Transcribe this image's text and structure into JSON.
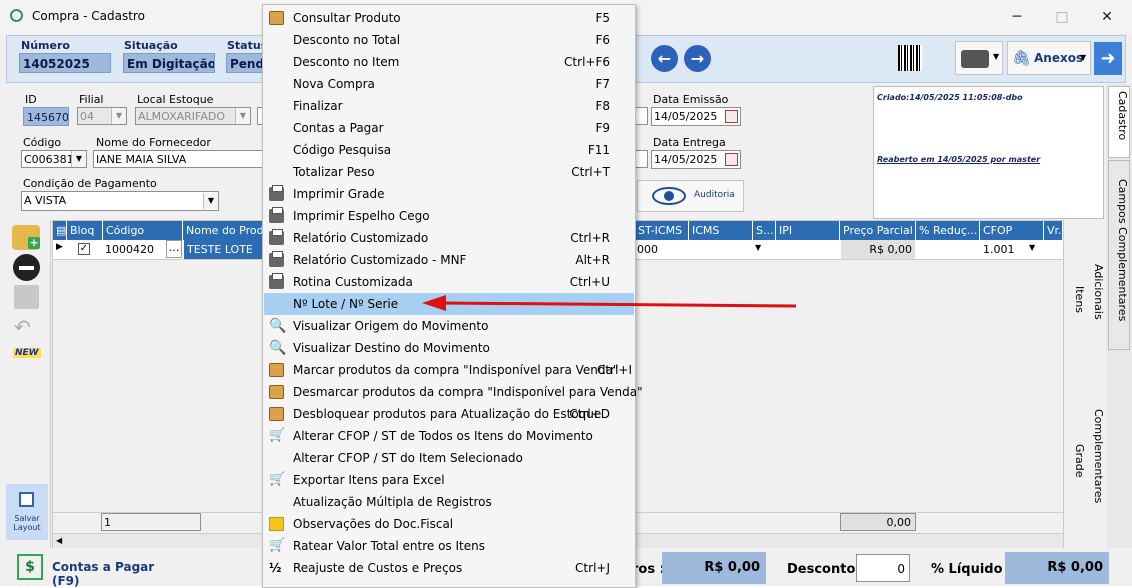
{
  "window": {
    "title": "Compra - Cadastro",
    "minimize": "─",
    "maximize": "□",
    "close": "✕"
  },
  "header": {
    "numero_label": "Número",
    "numero_value": "14052025",
    "situacao_label": "Situação",
    "situacao_value": "Em Digitação",
    "status_label": "Status",
    "status_value": "Pende",
    "anexos_label": "Anexos"
  },
  "form": {
    "id_label": "ID",
    "id_value": "145670",
    "filial_label": "Filial",
    "filial_value": "04",
    "local_estoque_label": "Local Estoque",
    "local_estoque_value": "ALMOXARIFADO",
    "data_emissao_label": "Data Emissão",
    "data_emissao_value": "14/05/2025",
    "codigo_label": "Código",
    "codigo_value": "C006381",
    "fornecedor_label": "Nome do Fornecedor",
    "fornecedor_value": "IANE MAIA SILVA",
    "data_entrega_label": "Data Entrega",
    "data_entrega_value": "14/05/2025",
    "cond_pagamento_label": "Condição de Pagamento",
    "cond_pagamento_value": "A VISTA",
    "auditoria_label": "Auditoria"
  },
  "log": {
    "criado": "Criado:14/05/2025 11:05:08-dbo",
    "reaberto": "Reaberto em 14/05/2025 por master"
  },
  "grid": {
    "headers": [
      "Bloq",
      "Código",
      "Nome do Prod",
      "ST-ICMS",
      "ICMS",
      "S...",
      "IPI",
      "Preço Parcial",
      "% Reduç...",
      "CFOP",
      "Vr.F"
    ],
    "row": {
      "codigo": "1000420",
      "nome": "TESTE LOTE",
      "st_icms": "000",
      "preco_parcial": "R$ 0,00",
      "cfop": "1.001"
    },
    "footer_count": "1",
    "footer_total": "0,00"
  },
  "left_toolbar": {
    "new_label": "NEW",
    "salvar_layout": "Salvar Layout"
  },
  "right_tabs": [
    "Cadastro",
    "Campos Complementares",
    "Adicionais",
    "Itens",
    "Complementares",
    "Grade"
  ],
  "bottom": {
    "contas_pagar": "Contas a Pagar (F9)",
    "tros_label": "ros :",
    "tros_value": "R$ 0,00",
    "desconto_label": "Desconto :",
    "desconto_value": "0",
    "liquido_label": "% Líquido :",
    "liquido_value": "R$ 0,00"
  },
  "context_menu": {
    "items": [
      {
        "label": "Consultar Produto",
        "shortcut": "F5",
        "icon": "box-icon"
      },
      {
        "label": "Desconto no Total",
        "shortcut": "F6",
        "icon": ""
      },
      {
        "label": "Desconto no Item",
        "shortcut": "Ctrl+F6",
        "icon": ""
      },
      {
        "label": "Nova Compra",
        "shortcut": "F7",
        "icon": ""
      },
      {
        "label": "Finalizar",
        "shortcut": "F8",
        "icon": ""
      },
      {
        "label": "Contas a Pagar",
        "shortcut": "F9",
        "icon": ""
      },
      {
        "label": "Código Pesquisa",
        "shortcut": "F11",
        "icon": ""
      },
      {
        "label": "Totalizar Peso",
        "shortcut": "Ctrl+T",
        "icon": ""
      },
      {
        "label": "Imprimir Grade",
        "shortcut": "",
        "icon": "printer-icon"
      },
      {
        "label": "Imprimir Espelho Cego",
        "shortcut": "",
        "icon": "printer-icon"
      },
      {
        "label": "Relatório Customizado",
        "shortcut": "Ctrl+R",
        "icon": "printer-icon"
      },
      {
        "label": "Relatório Customizado - MNF",
        "shortcut": "Alt+R",
        "icon": "printer-icon"
      },
      {
        "label": "Rotina Customizada",
        "shortcut": "Ctrl+U",
        "icon": "printer-icon"
      },
      {
        "label": "Nº Lote / Nº Serie",
        "shortcut": "",
        "icon": ""
      },
      {
        "label": "Visualizar Origem do Movimento",
        "shortcut": "",
        "icon": "magnifier-icon"
      },
      {
        "label": "Visualizar Destino do Movimento",
        "shortcut": "",
        "icon": "magnifier-icon"
      },
      {
        "label": "Marcar produtos da compra \"Indisponível para Venda\"",
        "shortcut": "Ctrl+I",
        "icon": "box-icon"
      },
      {
        "label": "Desmarcar produtos da compra \"Indisponível para Venda\"",
        "shortcut": "",
        "icon": "box-icon"
      },
      {
        "label": "Desbloquear produtos para Atualização do Estoque",
        "shortcut": "Ctrl+D",
        "icon": "box-icon"
      },
      {
        "label": "Alterar CFOP / ST de Todos os Itens do Movimento",
        "shortcut": "",
        "icon": "cart-icon"
      },
      {
        "label": "Alterar CFOP / ST do Item Selecionado",
        "shortcut": "",
        "icon": ""
      },
      {
        "label": "Exportar Itens para Excel",
        "shortcut": "",
        "icon": "cart-icon"
      },
      {
        "label": "Atualização Múltipla de Registros",
        "shortcut": "",
        "icon": ""
      },
      {
        "label": "Observações do Doc.Fiscal",
        "shortcut": "",
        "icon": "note-icon"
      },
      {
        "label": "Ratear Valor Total entre os Itens",
        "shortcut": "",
        "icon": "cart-icon"
      },
      {
        "label": "Reajuste de Custos e Preços",
        "shortcut": "Ctrl+J",
        "icon": "half-icon"
      }
    ],
    "selected_index": 13
  },
  "colors": {
    "accent_blue": "#2c6cb3",
    "menu_highlight": "#a6cff2",
    "arrow_red": "#e01010"
  }
}
